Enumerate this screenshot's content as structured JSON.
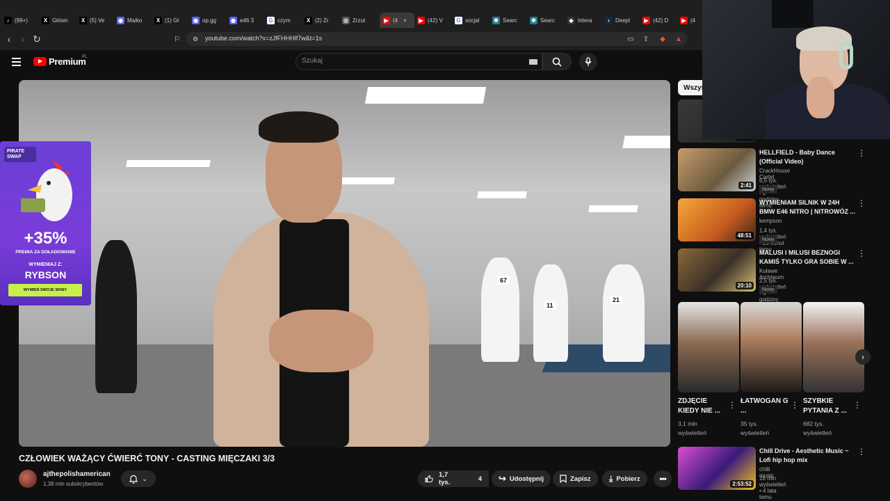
{
  "browser": {
    "tabs": [
      {
        "label": "(99+)",
        "icon": "tiktok",
        "color": "#000000"
      },
      {
        "label": "Główn",
        "icon": "x",
        "color": "#000000"
      },
      {
        "label": "(5) Ve",
        "icon": "x",
        "color": "#000000"
      },
      {
        "label": "Maiko",
        "icon": "discord",
        "color": "#5865f2"
      },
      {
        "label": "(1) Gł",
        "icon": "x",
        "color": "#000000"
      },
      {
        "label": "op.gg",
        "icon": "discord",
        "color": "#5865f2"
      },
      {
        "label": "e46 3",
        "icon": "discord",
        "color": "#5865f2"
      },
      {
        "label": "czym",
        "icon": "google",
        "color": "#ffffff"
      },
      {
        "label": "(2) Zr",
        "icon": "x",
        "color": "#000000"
      },
      {
        "label": "Zrzut",
        "icon": "globe",
        "color": "#555555"
      },
      {
        "label": "(4",
        "icon": "youtube",
        "color": "#ff0000",
        "active": true
      },
      {
        "label": "(42) V",
        "icon": "youtube",
        "color": "#ff0000"
      },
      {
        "label": "socjal",
        "icon": "google",
        "color": "#ffffff"
      },
      {
        "label": "Searc",
        "icon": "perplexity",
        "color": "#20808d"
      },
      {
        "label": "Searc",
        "icon": "perplexity",
        "color": "#20808d"
      },
      {
        "label": "Intera",
        "icon": "diamond",
        "color": "#333333"
      },
      {
        "label": "Deepl",
        "icon": "chevron",
        "color": "#0f2b46"
      },
      {
        "label": "(42) D",
        "icon": "youtube",
        "color": "#ff0000"
      },
      {
        "label": "(4",
        "icon": "youtube",
        "color": "#ff0000"
      }
    ],
    "url": "youtube.com/watch?v=zJfFHHHlf7w&t=1s"
  },
  "youtube": {
    "logo_text": "Premium",
    "region": "PL",
    "search_placeholder": "Szukaj"
  },
  "ad": {
    "brand": "PIRATE SWAP",
    "percent": "+35%",
    "line1": "PREMIA ZA DOŁADOWANIE",
    "line2": "WYMIENIAJ Z:",
    "code": "RYBSON",
    "button": "WYMIEŃ SWOJE SKINY"
  },
  "video": {
    "jerseys": [
      "67",
      "11",
      "21"
    ],
    "title": "CZŁOWIEK WAŻĄCY ĆWIERĆ TONY - CASTING MIĘCZAKI 3/3",
    "channel": "ajthepolishamerican",
    "subscribers": "1,38 mln subskrybentów",
    "likes": "1,7 tys.",
    "comments": "4",
    "share_label": "Udostępnij",
    "save_label": "Zapisz",
    "download_label": "Pobierz"
  },
  "sidebar": {
    "chip": "Wszys",
    "first_duration": "22:13",
    "recs": [
      {
        "title": "HELLFIELD - Baby Dance (Official Video)",
        "channel": "CrackHouse Cartel",
        "meta": "6,5 tys. wyświetleń • 2 godziny temu",
        "badge": "Nowy",
        "duration": "2:41"
      },
      {
        "title": "WYMIENIAM SILNIK W 24H BMW E46 NITRO | NITROWÓZ ...",
        "channel": "kempson",
        "meta": "1,4 tys. wyświetleń • 29 minut temu",
        "badge": "Nowy",
        "duration": "48:51"
      },
      {
        "title": "MALUSI I MILUSI BEZNOGI KAMIŚ TYLKO GRA SOBIE W ...",
        "channel": "Kulawe Archiwum",
        "meta": "2,5 tys. wyświetleń • 4 godziny temu",
        "badge": "Nowy",
        "duration": "20:10"
      }
    ],
    "shorts": [
      {
        "title": "ZDJĘCIE KIEDY NIE ...",
        "meta": "3,1 mln wyświetleń"
      },
      {
        "title": "ŁATWOGAN G ...",
        "meta": "35 tys. wyświetleń"
      },
      {
        "title": "SZYBKIE PYTANIA Z ...",
        "meta": "682 tys. wyświetleń"
      }
    ],
    "last_rec": {
      "title": "Chill Drive - Aesthetic Music ~ Lofi hip hop mix",
      "channel": "chilli music",
      "meta": "16 mln wyświetleń • 4 lata temu",
      "duration": "2:53:52"
    }
  },
  "colors": {
    "accent": "#ff0000",
    "background": "#0f0f0f"
  }
}
